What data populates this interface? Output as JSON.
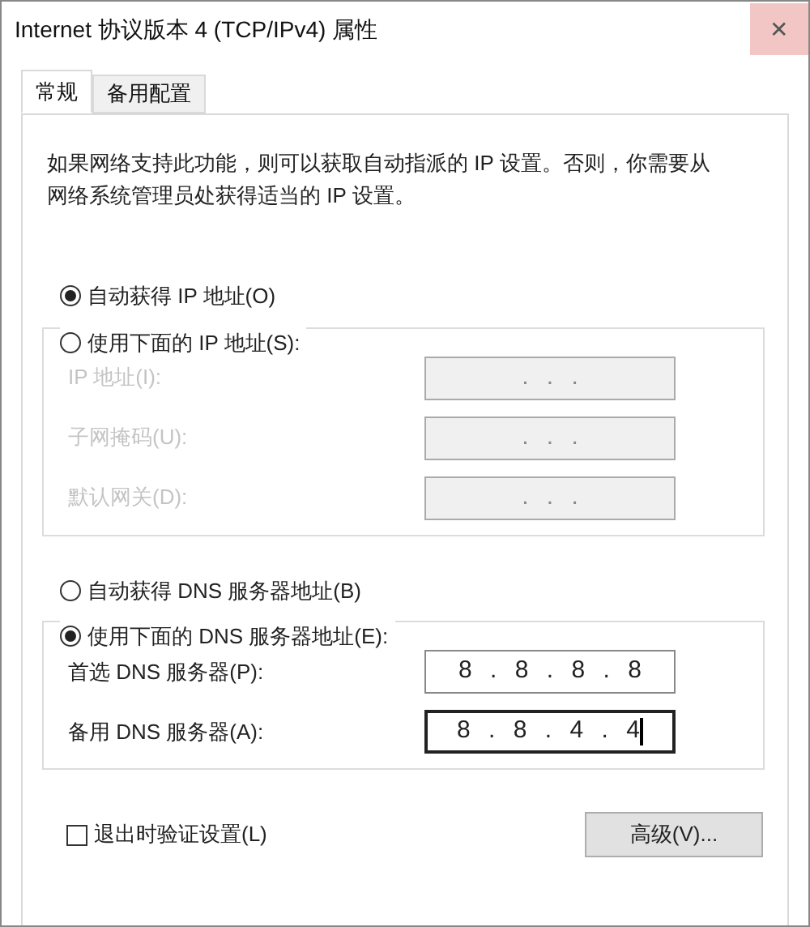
{
  "window": {
    "title": "Internet 协议版本 4 (TCP/IPv4) 属性",
    "close": "✕"
  },
  "tabs": [
    {
      "label": "常规",
      "selected": true
    },
    {
      "label": "备用配置",
      "selected": false
    }
  ],
  "description": "如果网络支持此功能，则可以获取自动指派的 IP 设置。否则，你需要从网络系统管理员处获得适当的 IP 设置。",
  "ip_section": {
    "auto_option": {
      "label": "自动获得 IP 地址(O)",
      "selected": true
    },
    "manual_option": {
      "label": "使用下面的 IP 地址(S):",
      "selected": false
    },
    "fields": [
      {
        "label": "IP 地址(I):",
        "value": ". . .",
        "disabled": true,
        "focused": false
      },
      {
        "label": "子网掩码(U):",
        "value": ". . .",
        "disabled": true,
        "focused": false
      },
      {
        "label": "默认网关(D):",
        "value": ". . .",
        "disabled": true,
        "focused": false
      }
    ]
  },
  "dns_section": {
    "auto_option": {
      "label": "自动获得 DNS 服务器地址(B)",
      "selected": false
    },
    "manual_option": {
      "label": "使用下面的 DNS 服务器地址(E):",
      "selected": true
    },
    "fields": [
      {
        "label": "首选 DNS 服务器(P):",
        "value": "8 . 8 . 8 . 8",
        "disabled": false,
        "focused": false
      },
      {
        "label": "备用 DNS 服务器(A):",
        "value": "8 . 8 . 4 . 4",
        "disabled": false,
        "focused": true
      }
    ]
  },
  "validate_checkbox": {
    "label": "退出时验证设置(L)",
    "checked": false
  },
  "advanced_button": "高级(V)..."
}
